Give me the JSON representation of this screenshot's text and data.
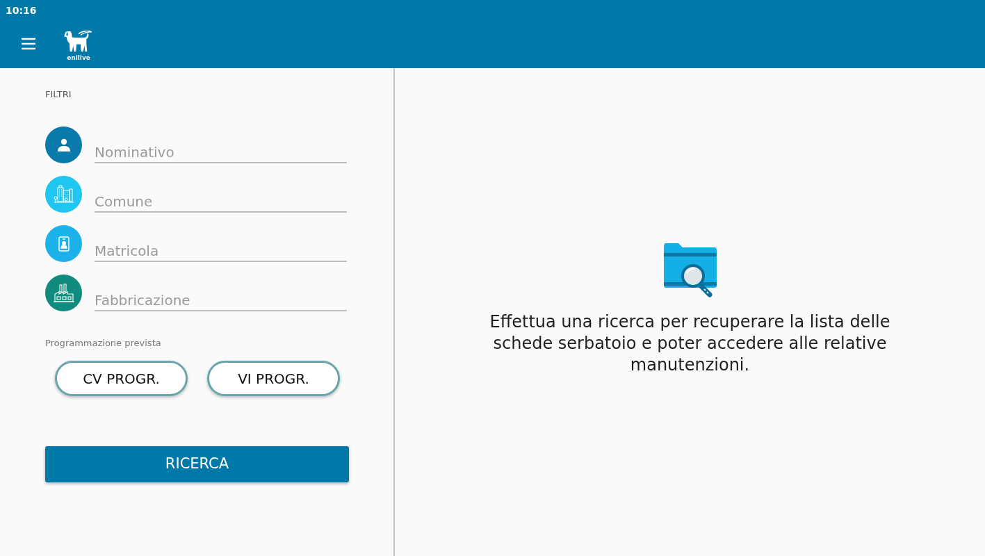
{
  "status_bar": {
    "time": "10:16"
  },
  "app_bar": {
    "logo_text": "enilive"
  },
  "filters": {
    "title": "FILTRI",
    "fields": [
      {
        "kind": "person",
        "placeholder": "Nominativo",
        "color": "#0a7aab"
      },
      {
        "kind": "city",
        "placeholder": "Comune",
        "color": "#1fc6ef"
      },
      {
        "kind": "badge",
        "placeholder": "Matricola",
        "color": "#1bb2ea"
      },
      {
        "kind": "factory",
        "placeholder": "Fabbricazione",
        "color": "#108b7d"
      }
    ],
    "schedule": {
      "label": "Programmazione prevista",
      "buttons": [
        "CV PROGR.",
        "VI PROGR."
      ]
    },
    "search_button": "RICERCA"
  },
  "empty_state": {
    "message": "Effettua una ricerca per recuperare la lista delle schede serbatoio e poter accedere alle relative manutenzioni."
  }
}
